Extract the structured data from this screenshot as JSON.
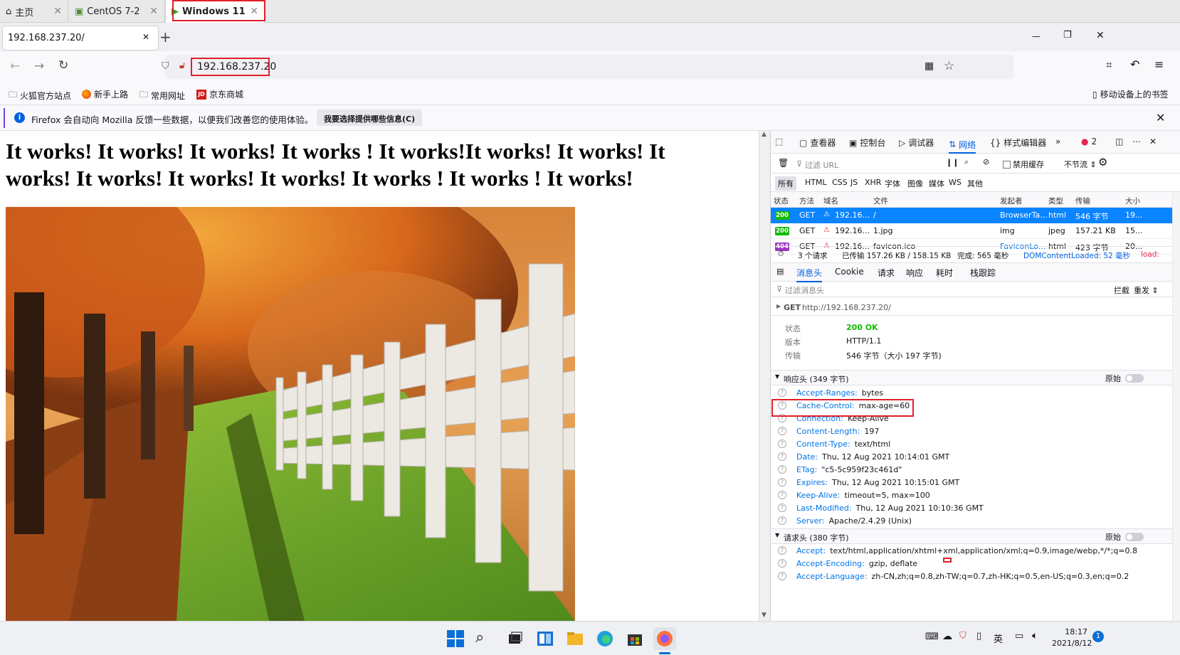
{
  "vm_tabs": [
    {
      "label": "主页"
    },
    {
      "label": "CentOS 7-2"
    },
    {
      "label": "Windows 11"
    }
  ],
  "ff_tab": {
    "title": "192.168.237.20/",
    "new_tab": "+"
  },
  "window_controls": {
    "min": "—",
    "max": "❐",
    "close": "✕"
  },
  "url": "192.168.237.20",
  "bookmarks": [
    "火狐官方站点",
    "新手上路",
    "常用网址",
    "京东商城"
  ],
  "mobile_bookmarks": "移动设备上的书签",
  "notification": {
    "text": "Firefox 会自动向 Mozilla 反馈一些数据，以便我们改善您的使用体验。",
    "button": "我要选择提供哪些信息(C)"
  },
  "page": {
    "headline": "It works! It works! It works! It works ! It works!It works! It works! It works! It works! It works! It works! It works ! It works ! It works!"
  },
  "devtools": {
    "tabs": [
      "查看器",
      "控制台",
      "调试器",
      "网络",
      "样式编辑器"
    ],
    "error_count": "2",
    "filter_url": "过滤 URL",
    "disable_cache": "禁用缓存",
    "throttle": "不节流 ⇕",
    "type_filters": [
      "所有",
      "HTML",
      "CSS",
      "JS",
      "XHR",
      "字体",
      "图像",
      "媒体",
      "WS",
      "其他"
    ],
    "columns": [
      "状态",
      "方法",
      "域名",
      "文件",
      "发起者",
      "类型",
      "传输",
      "大小"
    ],
    "requests": [
      {
        "status": "200",
        "method": "GET",
        "domain": "192.16...",
        "file": "/",
        "initiator": "BrowserTa...",
        "type": "html",
        "transfer": "546 字节",
        "size": "19..."
      },
      {
        "status": "200",
        "method": "GET",
        "domain": "192.16...",
        "file": "1.jpg",
        "initiator": "img",
        "type": "jpeg",
        "transfer": "157.21 KB",
        "size": "15..."
      },
      {
        "status": "404",
        "method": "GET",
        "domain": "192.16...",
        "file": "favicon.ico",
        "initiator": "FaviconLo...",
        "type": "html",
        "transfer": "423 字节",
        "size": "20..."
      }
    ],
    "summary": {
      "count": "3 个请求",
      "transferred": "已传输 157.26 KB / 158.15 KB",
      "finish": "完成: 565 毫秒",
      "dcl": "DOMContentLoaded: 52 毫秒",
      "load": "load:"
    },
    "detail_tabs": [
      "消息头",
      "Cookie",
      "请求",
      "响应",
      "耗时",
      "栈跟踪"
    ],
    "filter_headers": "过滤消息头",
    "block": "拦截",
    "resend": "重发 ⇕",
    "request_line": {
      "method": "GET",
      "url": "http://192.168.237.20/"
    },
    "status_block": [
      {
        "label": "状态",
        "value": "200 OK"
      },
      {
        "label": "版本",
        "value": "HTTP/1.1"
      },
      {
        "label": "传输",
        "value": "546 字节（大小 197 字节)"
      }
    ],
    "response_headers_title": "响应头 (349 字节)",
    "raw": "原始",
    "response_headers": [
      {
        "k": "Accept-Ranges:",
        "v": "bytes"
      },
      {
        "k": "Cache-Control:",
        "v": "max-age=60"
      },
      {
        "k": "Connection:",
        "v": "Keep-Alive"
      },
      {
        "k": "Content-Length:",
        "v": "197"
      },
      {
        "k": "Content-Type:",
        "v": "text/html"
      },
      {
        "k": "Date:",
        "v": "Thu, 12 Aug 2021 10:14:01 GMT"
      },
      {
        "k": "ETag:",
        "v": "\"c5-5c959f23c461d\""
      },
      {
        "k": "Expires:",
        "v": "Thu, 12 Aug 2021 10:15:01 GMT"
      },
      {
        "k": "Keep-Alive:",
        "v": "timeout=5, max=100"
      },
      {
        "k": "Last-Modified:",
        "v": "Thu, 12 Aug 2021 10:10:36 GMT"
      },
      {
        "k": "Server:",
        "v": "Apache/2.4.29 (Unix)"
      }
    ],
    "request_headers_title": "请求头 (380 字节)",
    "request_headers": [
      {
        "k": "Accept:",
        "v": "text/html,application/xhtml+xml,application/xml;q=0.9,image/webp,*/*;q=0.8"
      },
      {
        "k": "Accept-Encoding:",
        "v": "gzip, deflate"
      },
      {
        "k": "Accept-Language:",
        "v": "zh-CN,zh;q=0.8,zh-TW;q=0.7,zh-HK;q=0.5,en-US;q=0.3,en;q=0.2"
      }
    ]
  },
  "taskbar": {
    "time": "18:17",
    "date": "2021/8/12",
    "ime": "英",
    "badge": "1"
  },
  "colors": {
    "accent": "#0060df",
    "selected_row": "#0a84ff",
    "ok": "#12bc00",
    "notfound": "#9b32c7",
    "highlight": "#e0202a"
  }
}
